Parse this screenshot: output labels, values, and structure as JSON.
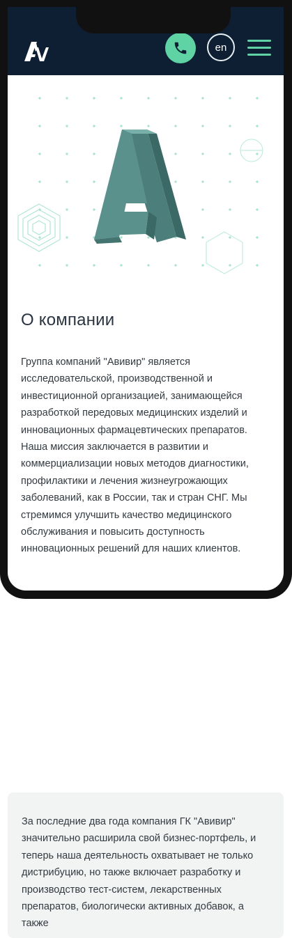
{
  "header": {
    "logo_alt": "AV",
    "call_icon": "phone-icon",
    "lang_label": "en",
    "menu_icon": "hamburger-menu-icon"
  },
  "about": {
    "title": "О компании",
    "text": "Группа компаний \"Авивир\" является исследовательской, производственной и инвестиционной организацией, занимающейся разработкой передовых медицинских изделий и инновационных фармацевтических препаратов. Наша миссия заключается в развитии и коммерциализации новых методов диагностики, профилактики и лечения жизнеугрожающих заболеваний, как в России, так и стран СНГ. Мы стремимся улучшить качество медицинского обслуживания и повысить доступность инновационных решений для наших клиентов."
  },
  "card": {
    "text": "За последние два года компания ГК \"Авивир\" значительно расширила свой бизнес-портфель, и теперь наша деятельность охватывает не только дистрибуцию, но также включает разработку и производство тест-систем, лекарственных препаратов, биологически активных добавок, а также"
  },
  "colors": {
    "header_bg": "#0f1f33",
    "accent": "#5fd3a3",
    "logo_3d": "#5a8a86"
  }
}
